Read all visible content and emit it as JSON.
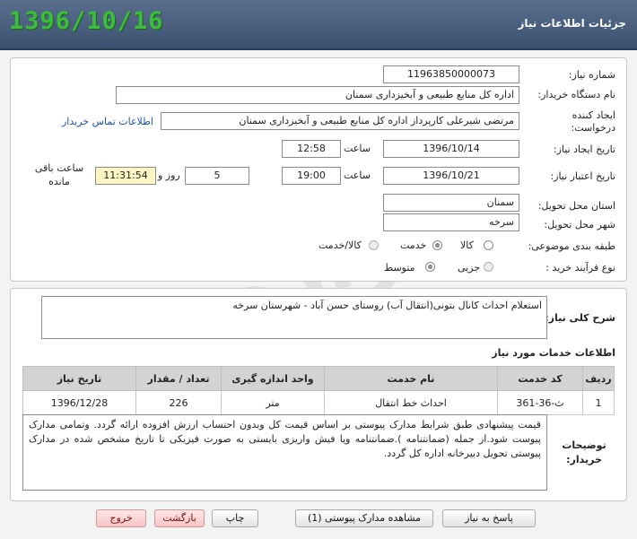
{
  "header": {
    "title": "جزئیات اطلاعات نیاز",
    "date": "1396/10/16"
  },
  "form": {
    "need_number": {
      "label": "شماره نیاز:",
      "value": "11963850000073"
    },
    "buyer_org": {
      "label": "نام دستگاه خریدار:",
      "value": "اداره کل منابع طبیعی و آبخیزداری سمنان"
    },
    "requester": {
      "label": "ایجاد کننده درخواست:",
      "value": "مرتضی شیرعلی کارپرداز اداره کل منابع طبیعی و آبخیزداری سمنان",
      "contact_link": "اطلاعات تماس خریدار"
    },
    "created": {
      "label": "تاریخ ایجاد نیاز:",
      "date": "1396/10/14",
      "time_label": "ساعت",
      "time": "12:58"
    },
    "validity": {
      "label": "تاریخ اعتبار نیاز:",
      "date": "1396/10/21",
      "time_label": "ساعت",
      "time": "19:00",
      "days": "5",
      "days_label": "روز و",
      "remaining": "11:31:54",
      "remaining_label": "ساعت باقی مانده"
    },
    "province": {
      "label": "استان محل تحویل:",
      "value": "سمنان"
    },
    "city": {
      "label": "شهر محل تحویل:",
      "value": "سرخه"
    },
    "category": {
      "label": "طبقه بندی موضوعی:",
      "options": [
        "کالا",
        "خدمت",
        "کالا/خدمت"
      ],
      "selected": "خدمت"
    },
    "process": {
      "label": "نوع فرآیند خرید :",
      "options": [
        "جزیی",
        "متوسط"
      ],
      "selected": "متوسط"
    }
  },
  "description": {
    "label": "شرح کلی نیاز:",
    "value": "استعلام احداث کانال بتونی(انتقال آب) روستای حسن آباد - شهرستان سرخه"
  },
  "services": {
    "title": "اطلاعات خدمات مورد نیاز",
    "columns": [
      "ردیف",
      "کد خدمت",
      "نام خدمت",
      "واحد اندازه گیری",
      "تعداد / مقدار",
      "تاریخ نیاز"
    ],
    "rows": [
      [
        "1",
        "ث-36-361",
        "احداث خط انتقال",
        "متر",
        "226",
        "1396/12/28"
      ]
    ]
  },
  "notes": {
    "label": "توضیحات خریدار:",
    "value": "قیمت پیشنهادی  طبق شرایط مدارک پیوستی بر اساس قیمت کل وبدون احتساب ارزش افزوده ارائه گردد. وتمامی مدارک پیوست شود.از جمله (ضمانتنامه ).ضمانتنامه ویا فیش واریزی بایستی به صورت فیزیکی تا تاریخ مشخص شده در مدارک پیوستی تحویل دبیرخانه اداره کل گردد."
  },
  "buttons": {
    "reply": "پاسخ به نیاز",
    "view_docs": "مشاهده مدارک پیوستی (1)",
    "print": "چاپ",
    "back": "بازگشت",
    "exit": "خروج"
  }
}
